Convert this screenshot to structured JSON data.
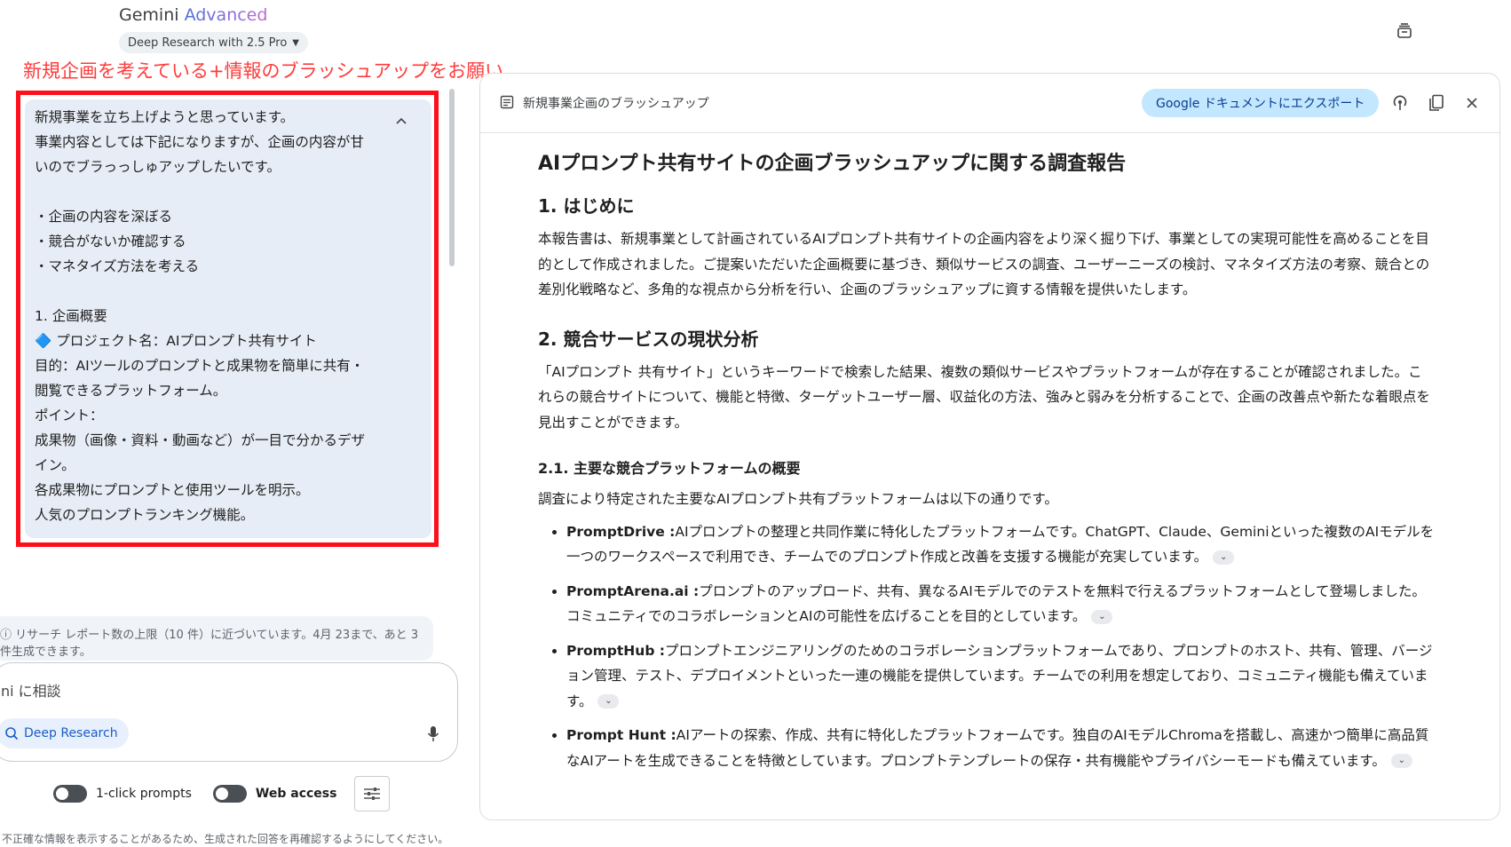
{
  "app": {
    "brand_name": "Gemini",
    "brand_tier": "Advanced",
    "model_selector": "Deep Research with 2.5 Pro"
  },
  "annotation": "新規企画を考えている+情報のブラッシュアップをお願い",
  "user_prompt": {
    "lines": [
      "新規事業を立ち上げようと思っています。",
      "事業内容としては下記になりますが、企画の内容が甘",
      "いのでブラっっしゅアップしたいです。",
      "",
      "・企画の内容を深ぼる",
      "・競合がないか確認する",
      "・マネタイズ方法を考える",
      "",
      "1. 企画概要",
      "🔷 プロジェクト名：AIプロンプト共有サイト",
      "目的：AIツールのプロンプトと成果物を簡単に共有・",
      "閲覧できるプラットフォーム。",
      "ポイント：",
      "成果物（画像・資料・動画など）が一目で分かるデザ",
      "イン。",
      "各成果物にプロンプトと使用ツールを明示。",
      "人気のプロンプトランキング機能。"
    ]
  },
  "composer": {
    "warning": "リサーチ レポート数の上限（10 件）に近づいています。4月 23まで、あと 3 件生成できます。",
    "placeholder": "ni に相談",
    "deep_research_label": "Deep Research",
    "toggle1_label": "1-click prompts",
    "toggle2_label": "Web access",
    "disclaimer": "不正確な情報を表示することがあるため、生成された回答を再確認するようにしてください。"
  },
  "document": {
    "tab_title": "新規事業企画のブラッシュアップ",
    "export_label": "Google ドキュメントにエクスポート",
    "title": "AIプロンプト共有サイトの企画ブラッシュアップに関する調査報告",
    "s1_heading": "1. はじめに",
    "s1_body": "本報告書は、新規事業として計画されているAIプロンプト共有サイトの企画内容をより深く掘り下げ、事業としての実現可能性を高めることを目的として作成されました。ご提案いただいた企画概要に基づき、類似サービスの調査、ユーザーニーズの検討、マネタイズ方法の考察、競合との差別化戦略など、多角的な視点から分析を行い、企画のブラッシュアップに資する情報を提供いたします。",
    "s2_heading": "2. 競合サービスの現状分析",
    "s2_body": "「AIプロンプト 共有サイト」というキーワードで検索した結果、複数の類似サービスやプラットフォームが存在することが確認されました。これらの競合サイトについて、機能と特徴、ターゲットユーザー層、収益化の方法、強みと弱みを分析することで、企画の改善点や新たな着眼点を見出すことができます。",
    "s21_heading": "2.1. 主要な競合プラットフォームの概要",
    "s21_intro": "調査により特定された主要なAIプロンプト共有プラットフォームは以下の通りです。",
    "items": [
      {
        "name": "PromptDrive :",
        "text": "AIプロンプトの整理と共同作業に特化したプラットフォームです。ChatGPT、Claude、Geminiといった複数のAIモデルを一つのワークスペースで利用でき、チームでのプロンプト作成と改善を支援する機能が充実しています。"
      },
      {
        "name": "PromptArena.ai :",
        "text": "プロンプトのアップロード、共有、異なるAIモデルでのテストを無料で行えるプラットフォームとして登場しました。コミュニティでのコラボレーションとAIの可能性を広げることを目的としています。"
      },
      {
        "name": "PromptHub :",
        "text": "プロンプトエンジニアリングのためのコラボレーションプラットフォームであり、プロンプトのホスト、共有、管理、バージョン管理、テスト、デプロイメントといった一連の機能を提供しています。チームでの利用を想定しており、コミュニティ機能も備えています。"
      },
      {
        "name": "Prompt Hunt :",
        "text": "AIアートの探索、作成、共有に特化したプラットフォームです。独自のAIモデルChromaを搭載し、高速かつ簡単に高品質なAIアートを生成できることを特徴としています。プロンプトテンプレートの保存・共有機能やプライバシーモードも備えています。"
      }
    ]
  }
}
